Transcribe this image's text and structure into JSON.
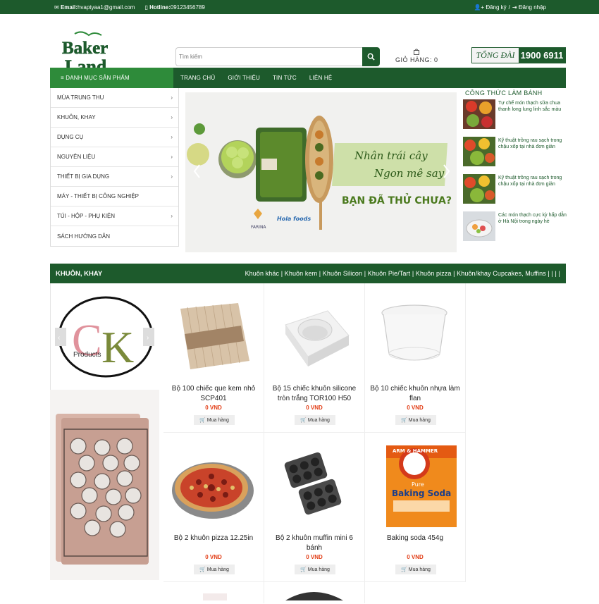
{
  "topbar": {
    "email_label": "Email:",
    "email": "hvaptyaa1@gmail.com",
    "hotline_label": "Hotline:",
    "hotline": "09123456789",
    "register": "Đăng ký",
    "separator": "/",
    "login": "Đăng nhập"
  },
  "header": {
    "logo_text": "Baker Land",
    "search_placeholder": "Tìm kiếm",
    "cart_label": "GIỎ HÀNG:",
    "cart_count": "0",
    "hotline_label": "TỔNG ĐÀI",
    "hotline_number": "1900 6911"
  },
  "nav": {
    "category_label": "DANH MỤC SẢN PHẨM",
    "items": [
      "TRANG CHỦ",
      "GIỚI THIỆU",
      "TIN TỨC",
      "LIÊN HỆ"
    ]
  },
  "sidebar": {
    "items": [
      {
        "label": "MÙA TRUNG THU",
        "arrow": "›"
      },
      {
        "label": "KHUÔN, KHAY",
        "arrow": "›"
      },
      {
        "label": "DỤNG CỤ",
        "arrow": "›"
      },
      {
        "label": "NGUYÊN LIỆU",
        "arrow": "›"
      },
      {
        "label": "THIẾT BỊ GIA DỤNG",
        "arrow": "›"
      },
      {
        "label": "MÁY - THIẾT BỊ CÔNG NGHIỆP",
        "arrow": ""
      },
      {
        "label": "TÚI - HỘP - PHỤ KIỆN",
        "arrow": "›"
      },
      {
        "label": "SÁCH HƯỚNG DẪN",
        "arrow": ""
      }
    ]
  },
  "banner": {
    "line1": "Nhân trái cây",
    "line2": "Ngon mê say",
    "line3": "BẠN ĐÃ THỬ CHƯA?",
    "brand1": "FARINA",
    "brand2": "Hola foods"
  },
  "recipes": {
    "title": "CÔNG THỨC LÀM BÁNH",
    "items": [
      "Tự chế món thạch sữa chua thanh long lung linh sắc màu",
      "Kỹ thuật trồng rau sạch trong chậu xốp tại nhà đơn giản",
      "Kỹ thuật trồng rau sạch trong chậu xốp tại nhà đơn giản",
      "Các món thạch cực kỳ hấp dẫn ở Hà Nội trong ngày hè"
    ]
  },
  "section": {
    "title": "KHUÔN, KHAY",
    "links": "Khuôn khác | Khuôn kem | Khuôn Silicon | Khuôn Pie/Tart | Khuôn pizza | Khuôn/khay Cupcakes, Muffins | | | |"
  },
  "brand": {
    "letter1": "C",
    "letter2": "K",
    "name": "Products"
  },
  "products": [
    {
      "name": "Bộ 100 chiếc que kem nhỏ SCP401",
      "price": "0 VND",
      "buy": "Mua hàng"
    },
    {
      "name": "Bộ 15 chiếc khuôn silicone tròn trắng TOR100 H50",
      "price": "0 VND",
      "buy": "Mua hàng"
    },
    {
      "name": "Bộ 10 chiếc khuôn nhựa làm flan",
      "price": "0 VND",
      "buy": "Mua hàng"
    },
    {
      "name": "Bộ 2 khuôn pizza 12.25in",
      "price": "0 VND",
      "buy": "Mua hàng"
    },
    {
      "name": "Bộ 2 khuôn muffin mini 6 bánh",
      "price": "0 VND",
      "buy": "Mua hàng"
    },
    {
      "name": "Baking soda 454g",
      "price": "0 VND",
      "buy": "Mua hàng"
    }
  ],
  "soda": {
    "brand": "ARM & HAMMER",
    "line1": "Pure",
    "line2": "Baking Soda"
  },
  "colors": {
    "primary": "#1d5a2c",
    "accent": "#2e8b3a",
    "price": "#e23b13"
  }
}
